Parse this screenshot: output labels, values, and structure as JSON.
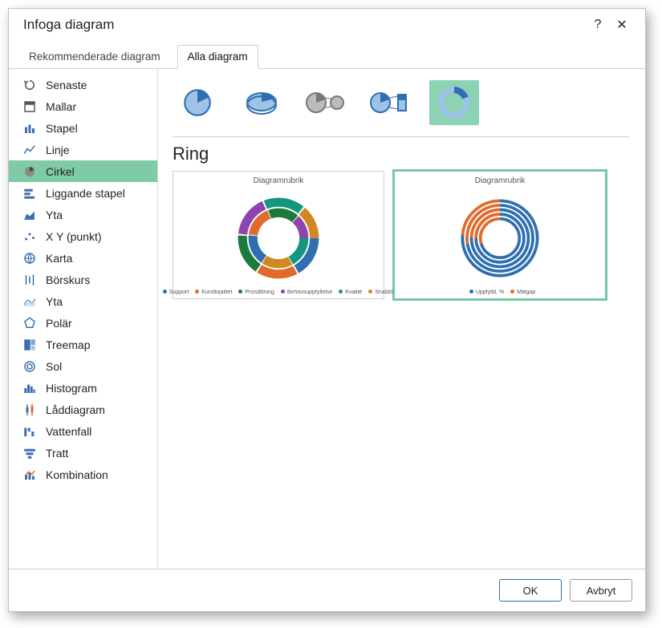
{
  "dialog": {
    "title": "Infoga diagram",
    "help": "?",
    "close": "✕"
  },
  "tabs": {
    "recommended": "Rekommenderade diagram",
    "all": "Alla diagram"
  },
  "sidebar": {
    "items": [
      {
        "label": "Senaste"
      },
      {
        "label": "Mallar"
      },
      {
        "label": "Stapel"
      },
      {
        "label": "Linje"
      },
      {
        "label": "Cirkel"
      },
      {
        "label": "Liggande stapel"
      },
      {
        "label": "Yta"
      },
      {
        "label": "X Y (punkt)"
      },
      {
        "label": "Karta"
      },
      {
        "label": "Börskurs"
      },
      {
        "label": "Yta"
      },
      {
        "label": "Polär"
      },
      {
        "label": "Treemap"
      },
      {
        "label": "Sol"
      },
      {
        "label": "Histogram"
      },
      {
        "label": "Låddiagram"
      },
      {
        "label": "Vattenfall"
      },
      {
        "label": "Tratt"
      },
      {
        "label": "Kombination"
      }
    ]
  },
  "content": {
    "section_title": "Ring",
    "previews": [
      {
        "title": "Diagramrubrik",
        "legend": [
          {
            "color": "#2f6fb0",
            "label": "Support"
          },
          {
            "color": "#e06a2b",
            "label": "Kundlojalitet"
          },
          {
            "color": "#1e7a3c",
            "label": "Prissättning"
          },
          {
            "color": "#8e44ad",
            "label": "Behovsuppfyllelse"
          },
          {
            "color": "#14967f",
            "label": "Kvalité"
          },
          {
            "color": "#d08820",
            "label": "Snabbhet"
          }
        ]
      },
      {
        "title": "Diagramrubrik",
        "legend": [
          {
            "color": "#2f6fb0",
            "label": "Uppfylld, %"
          },
          {
            "color": "#e06a2b",
            "label": "Målgap"
          }
        ]
      }
    ]
  },
  "footer": {
    "ok": "OK",
    "cancel": "Avbryt"
  },
  "chart_data": [
    {
      "type": "pie",
      "style": "doughnut-multiring",
      "title": "Diagramrubrik",
      "rings": 2,
      "categories": [
        "Support",
        "Kundlojalitet",
        "Prissättning",
        "Behovsuppfyllelse",
        "Kvalité",
        "Snabbhet"
      ],
      "colors": [
        "#2f6fb0",
        "#e06a2b",
        "#1e7a3c",
        "#8e44ad",
        "#14967f",
        "#d08820"
      ]
    },
    {
      "type": "pie",
      "style": "doughnut-multiring",
      "title": "Diagramrubrik",
      "rings": 5,
      "categories": [
        "Uppfylld, %",
        "Målgap"
      ],
      "colors": [
        "#2f6fb0",
        "#e06a2b"
      ]
    }
  ]
}
